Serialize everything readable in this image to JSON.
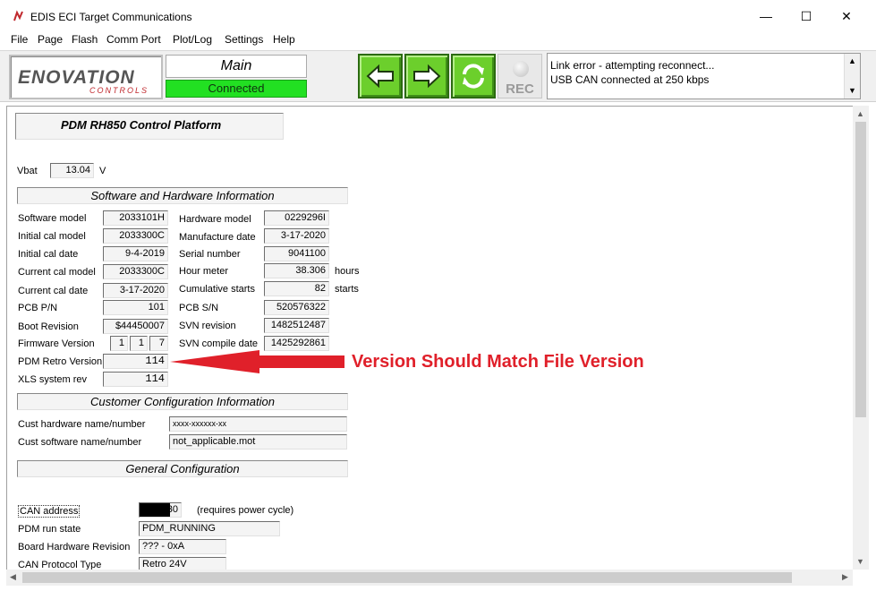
{
  "window": {
    "title": "EDIS ECI Target Communications",
    "minimize_glyph": "—",
    "maximize_glyph": "☐",
    "close_glyph": "✕"
  },
  "menu": [
    "File",
    "Page",
    "Flash",
    "Comm Port",
    "Plot/Log",
    "Settings",
    "Help"
  ],
  "toolbar": {
    "logo_text": "ENOVATION",
    "logo_sub": "CONTROLS",
    "page_name": "Main",
    "connection_status": "Connected",
    "rec_label": "REC",
    "log_lines": [
      "Link error - attempting reconnect...",
      "USB CAN connected at 250 kbps"
    ]
  },
  "colors": {
    "status_green": "#22e022",
    "nav_green": "#6ccf2c",
    "annotation_red": "#e0202a"
  },
  "icons": {
    "back": "arrow-left-icon",
    "forward": "arrow-right-icon",
    "refresh": "refresh-icon",
    "record": "record-icon"
  },
  "platform_title": "PDM RH850 Control Platform",
  "vbat": {
    "label": "Vbat",
    "value": "13.04",
    "unit": "V"
  },
  "sections": {
    "software_hardware": "Software and Hardware Information",
    "customer_config": "Customer Configuration Information",
    "general_config": "General Configuration"
  },
  "sw_left": [
    {
      "label": "Software model",
      "value": "2033101H"
    },
    {
      "label": "Initial cal model",
      "value": "2033300C"
    },
    {
      "label": "Initial cal date",
      "value": "9-4-2019"
    },
    {
      "label": "Current cal model",
      "value": "2033300C"
    },
    {
      "label": "Current cal date",
      "value": "3-17-2020"
    },
    {
      "label": "PCB P/N",
      "value": "101"
    },
    {
      "label": "Boot Revision",
      "value": "$44450007"
    }
  ],
  "firmware_version": {
    "label": "Firmware Version",
    "major": "1",
    "minor": "1",
    "patch": "7"
  },
  "pdm_retro": {
    "label": "PDM Retro Version",
    "value": "114"
  },
  "xls_rev": {
    "label": "XLS system rev",
    "value": "114"
  },
  "hw_right": [
    {
      "label": "Hardware model",
      "value": "0229296I",
      "unit": ""
    },
    {
      "label": "Manufacture date",
      "value": "3-17-2020",
      "unit": ""
    },
    {
      "label": "Serial number",
      "value": "9041100",
      "unit": ""
    },
    {
      "label": "Hour meter",
      "value": "38.306",
      "unit": "hours"
    },
    {
      "label": "Cumulative starts",
      "value": "82",
      "unit": "starts"
    },
    {
      "label": "PCB S/N",
      "value": "520576322",
      "unit": ""
    },
    {
      "label": "SVN revision",
      "value": "1482512487",
      "unit": ""
    },
    {
      "label": "SVN compile date",
      "value": "1425292861",
      "unit": ""
    }
  ],
  "customer": [
    {
      "label": "Cust hardware name/number",
      "value": "xxxx-xxxxxx-xx"
    },
    {
      "label": "Cust software name/number",
      "value": "not_applicable.mot"
    }
  ],
  "general": {
    "can_address_label": "CAN address",
    "can_address_value": "30",
    "can_address_note": "(requires power cycle)",
    "run_state_label": "PDM run state",
    "run_state_value": "PDM_RUNNING",
    "board_hw_label": "Board Hardware Revision",
    "board_hw_value": "??? - 0xA",
    "can_protocol_label": "CAN Protocol Type",
    "can_protocol_value": "Retro 24V"
  },
  "annotation": "Version Should Match File Version"
}
